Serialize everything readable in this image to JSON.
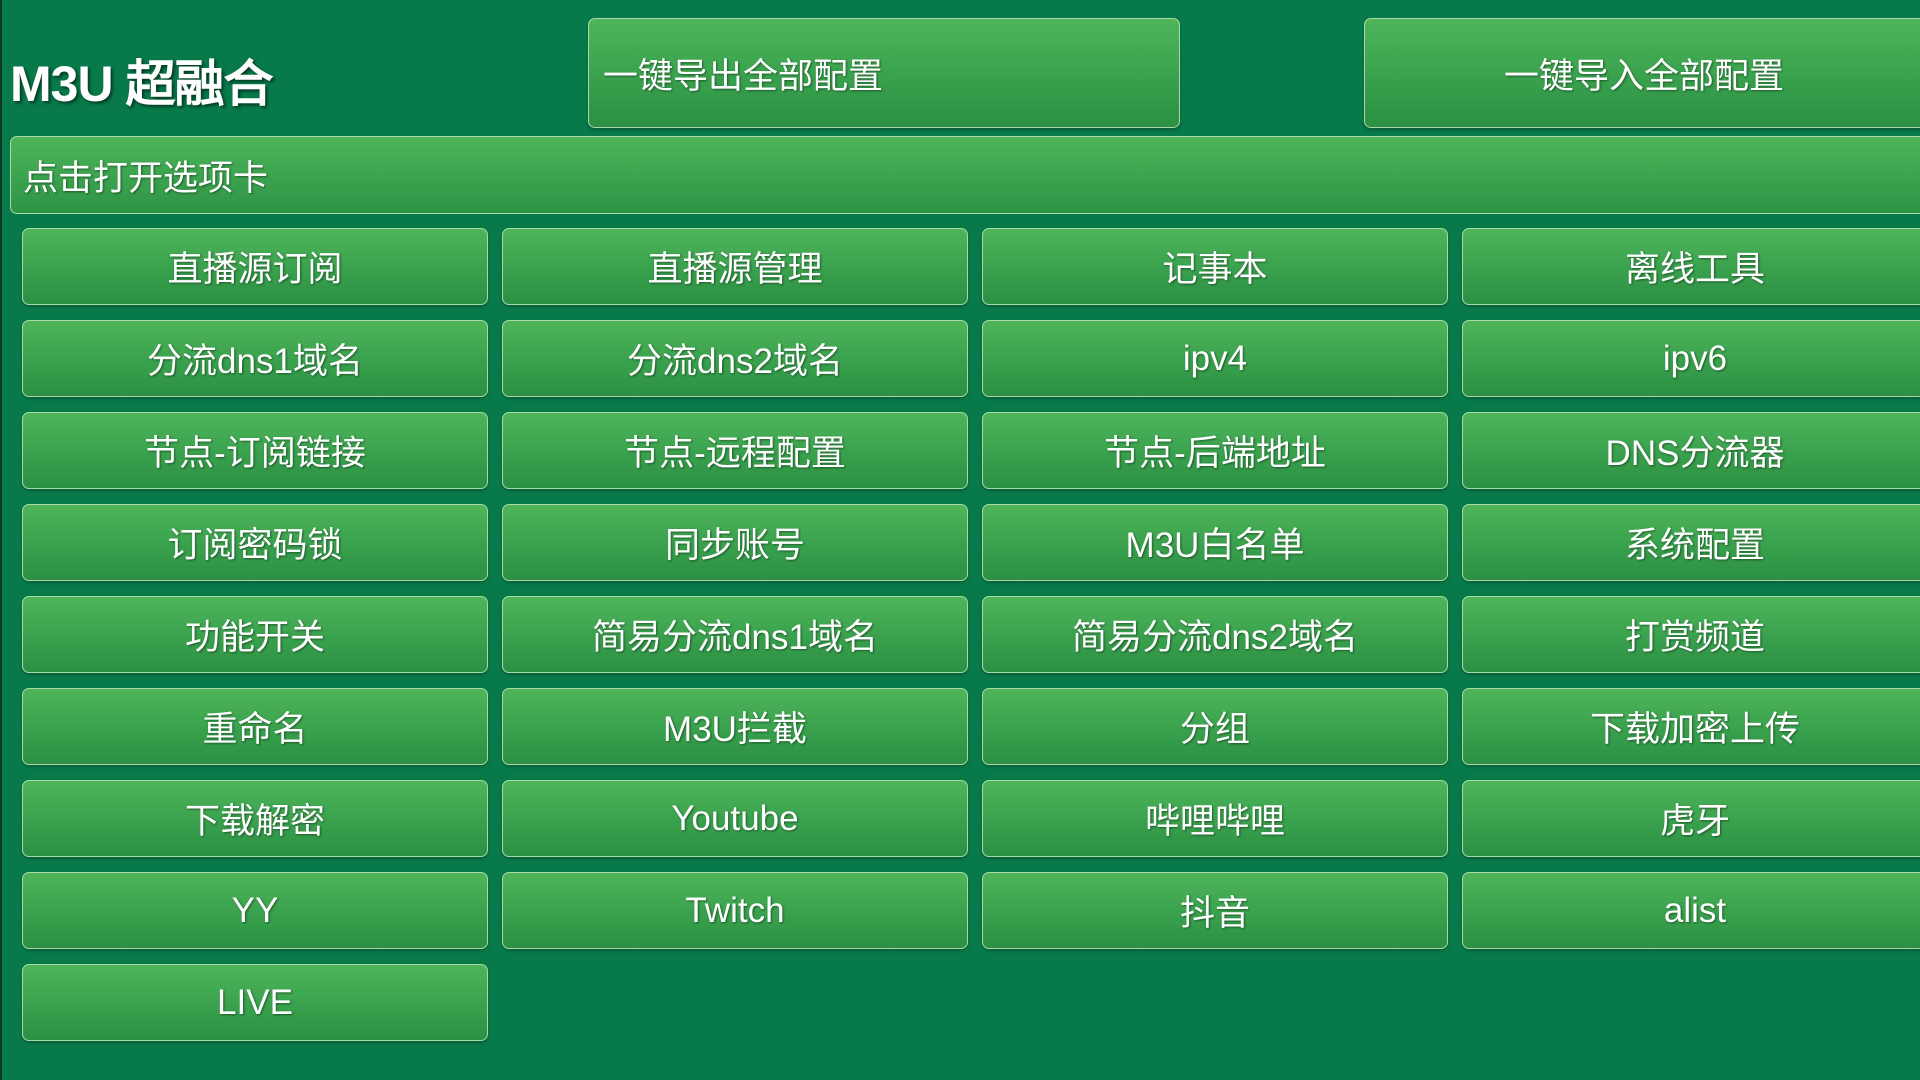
{
  "app": {
    "title": "M3U 超融合"
  },
  "header": {
    "export_label": "一键导出全部配置",
    "import_label": "一键导入全部配置"
  },
  "tabs_toggle": {
    "label": "点击打开选项卡"
  },
  "menu": {
    "items": [
      "直播源订阅",
      "直播源管理",
      "记事本",
      "离线工具",
      "分流dns1域名",
      "分流dns2域名",
      "ipv4",
      "ipv6",
      "节点-订阅链接",
      "节点-远程配置",
      "节点-后端地址",
      "DNS分流器",
      "订阅密码锁",
      "同步账号",
      "M3U白名单",
      "系统配置",
      "功能开关",
      "简易分流dns1域名",
      "简易分流dns2域名",
      "打赏频道",
      "重命名",
      "M3U拦截",
      "分组",
      "下载加密上传",
      "下载解密",
      "Youtube",
      "哔哩哔哩",
      "虎牙",
      "YY",
      "Twitch",
      "抖音",
      "alist",
      "LIVE"
    ]
  },
  "colors": {
    "background": "#087a4a",
    "button_top": "#4fb55b",
    "button_bottom": "#2b9043",
    "button_border": "#a9d9a9",
    "text": "#ffffff"
  }
}
